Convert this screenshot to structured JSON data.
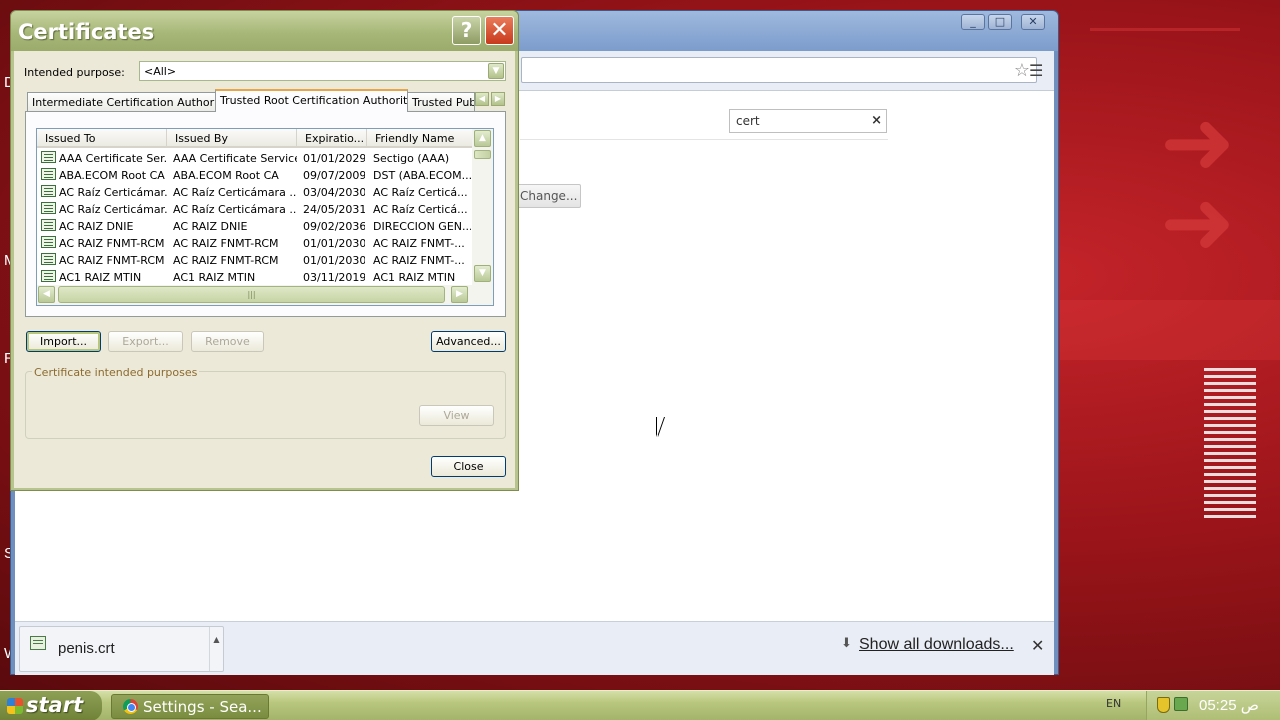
{
  "dialog": {
    "title": "Certificates",
    "help_label": "?",
    "close_label": "✕",
    "intended_purpose_label": "Intended purpose:",
    "intended_purpose_value": "<All>",
    "tabs": [
      {
        "label": "Intermediate Certification Authorities",
        "active": false
      },
      {
        "label": "Trusted Root Certification Authorities",
        "active": true
      },
      {
        "label": "Trusted Publi",
        "active": false
      }
    ],
    "columns": [
      "Issued To",
      "Issued By",
      "Expiratio...",
      "Friendly Name"
    ],
    "rows": [
      {
        "issued_to": "AAA Certificate Ser...",
        "issued_by": "AAA Certificate Services",
        "expiration": "01/01/2029",
        "friendly_name": "Sectigo (AAA)"
      },
      {
        "issued_to": "ABA.ECOM Root CA",
        "issued_by": "ABA.ECOM Root CA",
        "expiration": "09/07/2009",
        "friendly_name": "DST (ABA.ECOM..."
      },
      {
        "issued_to": "AC Raíz Certicámar...",
        "issued_by": "AC Raíz Certicámara ...",
        "expiration": "03/04/2030",
        "friendly_name": "AC Raíz Certicá..."
      },
      {
        "issued_to": "AC Raíz Certicámar...",
        "issued_by": "AC Raíz Certicámara ...",
        "expiration": "24/05/2031",
        "friendly_name": "AC Raíz Certicá..."
      },
      {
        "issued_to": "AC RAIZ DNIE",
        "issued_by": "AC RAIZ DNIE",
        "expiration": "09/02/2036",
        "friendly_name": "DIRECCION GEN..."
      },
      {
        "issued_to": "AC RAIZ FNMT-RCM",
        "issued_by": "AC RAIZ FNMT-RCM",
        "expiration": "01/01/2030",
        "friendly_name": "AC RAIZ FNMT-..."
      },
      {
        "issued_to": "AC RAIZ FNMT-RCM",
        "issued_by": "AC RAIZ FNMT-RCM",
        "expiration": "01/01/2030",
        "friendly_name": "AC RAIZ FNMT-..."
      },
      {
        "issued_to": "AC1 RAIZ MTIN",
        "issued_by": "AC1 RAIZ MTIN",
        "expiration": "03/11/2019",
        "friendly_name": "AC1 RAIZ MTIN"
      }
    ],
    "buttons": {
      "import": "Import...",
      "export": "Export...",
      "remove": "Remove",
      "advanced": "Advanced...",
      "view": "View",
      "close": "Close"
    },
    "purposes_group_label": "Certificate intended purposes"
  },
  "chrome": {
    "search_value": "cert",
    "search_clear": "×",
    "change_button": "Change...",
    "window_controls": [
      "_",
      "□",
      "✕"
    ]
  },
  "downloads": {
    "file_name": "penis.crt",
    "show_all": "Show all downloads...",
    "close": "✕",
    "chevron": "▲"
  },
  "taskbar": {
    "start_label": "start",
    "task_label": "Settings - Sea...",
    "language": "EN",
    "clock": "05:25 ص"
  },
  "desktop": {
    "side_letters": [
      "D",
      "M",
      "R",
      "S",
      "W"
    ]
  },
  "colors": {
    "dialog_frame": "#b7c48e",
    "taskbar": "#b8c77d",
    "desktop": "#9a1419",
    "chrome_frame": "#6f8fbf"
  }
}
